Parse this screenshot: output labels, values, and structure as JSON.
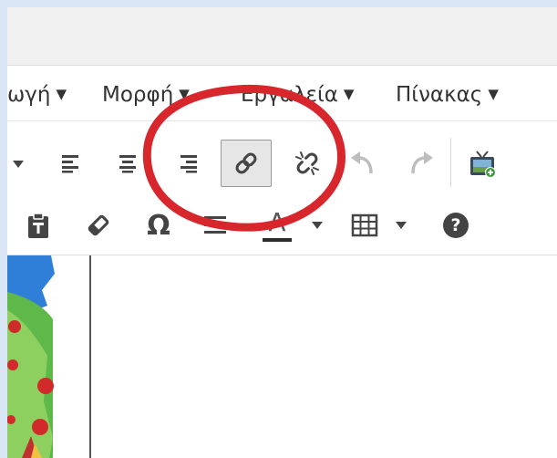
{
  "menubar": {
    "items": [
      {
        "label": "ωγή",
        "caret": "▼"
      },
      {
        "label": "Μορφή",
        "caret": "▼"
      },
      {
        "label": "Εργαλεία",
        "caret": "▼"
      },
      {
        "label": "Πίνακας",
        "caret": "▼"
      }
    ]
  },
  "toolbar": {
    "row1": [
      "dropdown-caret",
      "align-left",
      "align-center",
      "align-right",
      "insert-link (active)",
      "unlink",
      "undo (disabled)",
      "redo (disabled)",
      "insert-media"
    ],
    "row2": [
      "paste-as-text",
      "clear-formatting",
      "special-character",
      "horizontal-line",
      "text-color",
      "table",
      "help"
    ]
  },
  "icons": {
    "special_character": "Ω",
    "help": "?",
    "text_color": "A"
  },
  "colors": {
    "annotation": "#d8262d",
    "icon": "#444444",
    "disabled_icon": "#bdbdbd",
    "text_color_underline": "#2b2b2b"
  }
}
